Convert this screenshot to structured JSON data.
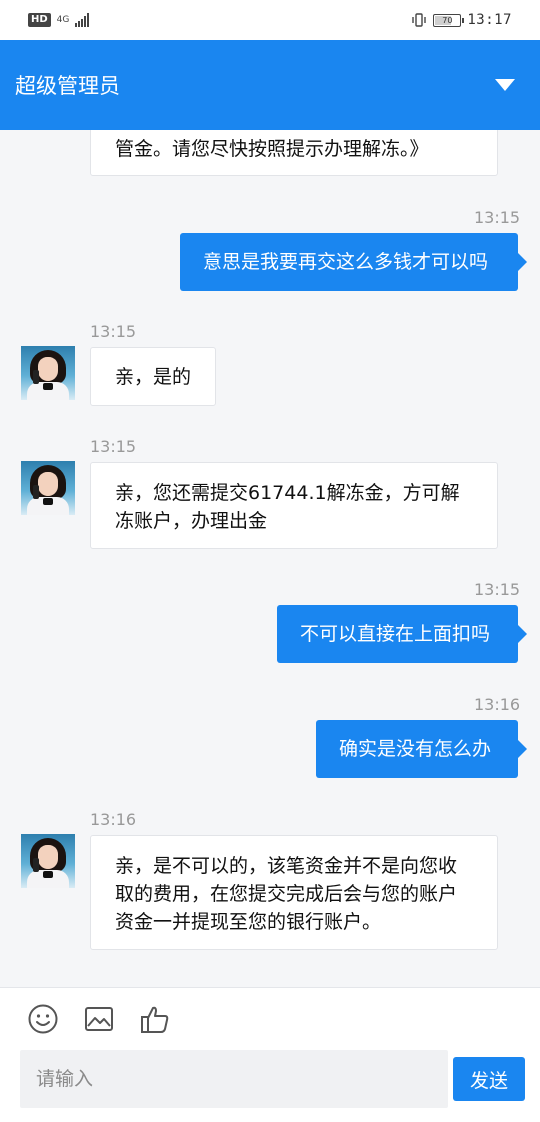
{
  "status_bar": {
    "hd": "HD",
    "network": "4G",
    "battery": "70",
    "battery_level": 0.7,
    "time": "13:17"
  },
  "header": {
    "title": "超级管理员",
    "dropdown_icon": "chevron-down-icon"
  },
  "messages": [
    {
      "side": "in",
      "text": "管金。请您尽快按照提示办理解冻。》"
    },
    {
      "side": "out",
      "time": "13:15",
      "text": "意思是我要再交这么多钱才可以吗"
    },
    {
      "side": "in",
      "time": "13:15",
      "text": "亲，是的"
    },
    {
      "side": "in",
      "time": "13:15",
      "lines": [
        "亲，您还需提交61744.1解冻金，方可解",
        "冻账户，办理出金"
      ]
    },
    {
      "side": "out",
      "time": "13:15",
      "text": "不可以直接在上面扣吗"
    },
    {
      "side": "out",
      "time": "13:16",
      "text": "确实是没有怎么办"
    },
    {
      "side": "in",
      "time": "13:16",
      "lines": [
        "亲，是不可以的，该笔资金并不是向您收",
        "取的费用，在您提交完成后会与您的账户",
        "资金一并提现至您的银行账户。"
      ]
    }
  ],
  "composer": {
    "placeholder": "请输入",
    "send_label": "发送",
    "icons": [
      "emoji-icon",
      "image-icon",
      "thumbs-up-icon"
    ]
  },
  "colors": {
    "accent": "#1a86f0",
    "background": "#f5f6f8"
  }
}
